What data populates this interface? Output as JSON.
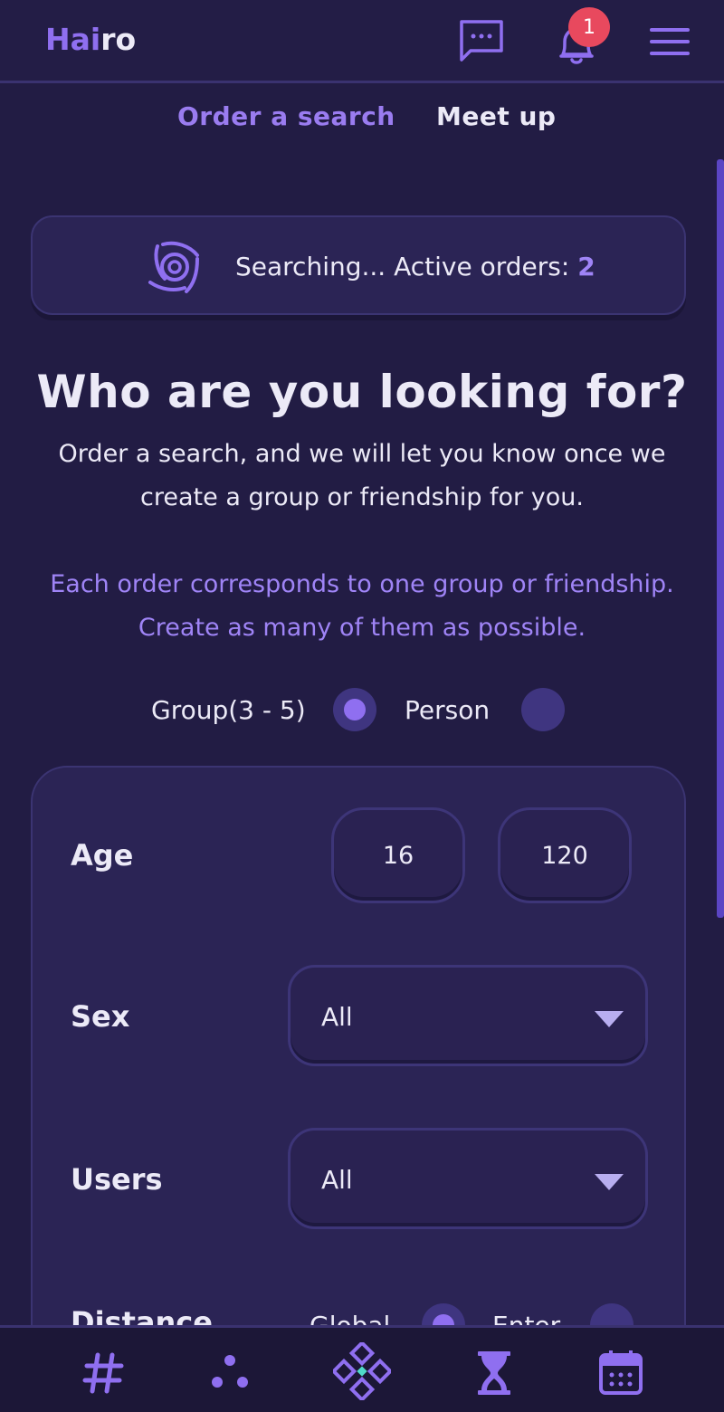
{
  "header": {
    "logo_part1": "Hai",
    "logo_part2": "ro",
    "notification_count": "1",
    "icons": [
      "chat-icon",
      "bell-icon",
      "menu-icon"
    ]
  },
  "tabs": [
    {
      "label": "Order a search",
      "active": true
    },
    {
      "label": "Meet up",
      "active": false
    }
  ],
  "status": {
    "text": "Searching... Active orders: ",
    "count": "2",
    "icon": "search-radar-icon"
  },
  "intro": {
    "headline": "Who are you looking for?",
    "subtitle": "Order a search, and we will let you know once we create a group or friendship for you.",
    "note": "Each order corresponds to one group or friendship. Create as many of them as possible."
  },
  "search_type": {
    "options": [
      {
        "label": "Group(3 - 5)",
        "selected": true
      },
      {
        "label": "Person",
        "selected": false
      }
    ]
  },
  "filters": {
    "age": {
      "label": "Age",
      "min": "16",
      "max": "120"
    },
    "sex": {
      "label": "Sex",
      "value": "All"
    },
    "users": {
      "label": "Users",
      "value": "All"
    },
    "distance": {
      "label": "Distance",
      "options": [
        {
          "label": "Global",
          "selected": true
        },
        {
          "label": "Enter",
          "selected": false
        }
      ]
    }
  },
  "bottom_nav": {
    "items": [
      "hashtag-icon",
      "dots-icon",
      "diamond-icon",
      "hourglass-icon",
      "calendar-icon"
    ]
  },
  "colors": {
    "background": "#221c44",
    "accent": "#8f6ff0",
    "badge": "#e8495e",
    "card": "#2b2455"
  }
}
